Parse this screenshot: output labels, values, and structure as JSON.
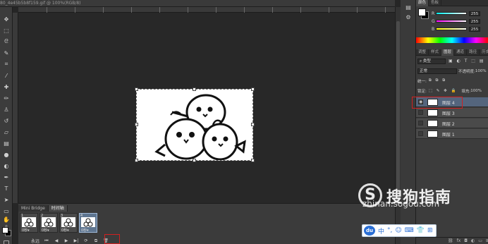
{
  "app": {
    "document_title": "80_4e45b5b8f159.gif @ 100%(RGB/8)"
  },
  "color_panel": {
    "tabs": [
      "颜色",
      "色板"
    ],
    "sliders": [
      {
        "label": "R",
        "value": "255",
        "color_from": "#00ffff",
        "color_to": "#ffffff"
      },
      {
        "label": "G",
        "value": "255",
        "color_from": "#ff00ff",
        "color_to": "#ffffff"
      },
      {
        "label": "B",
        "value": "255",
        "color_from": "#ffff00",
        "color_to": "#ffffff"
      }
    ],
    "foreground": "#ffffff",
    "background": "#000000"
  },
  "layers_panel": {
    "tabs": [
      "调整",
      "样式",
      "图层",
      "通道",
      "路径",
      "历史"
    ],
    "filter_label": "类型",
    "blend_mode": "正常",
    "opacity_label": "不透明度:",
    "opacity_value": "100%",
    "lock_label": "锁定:",
    "fill_label": "填充:",
    "fill_value": "100%",
    "unify_label": "统一:",
    "layers": [
      {
        "name": "图层 4",
        "visible": true,
        "selected": true
      },
      {
        "name": "图层 3",
        "visible": false,
        "selected": false
      },
      {
        "name": "图层 2",
        "visible": false,
        "selected": false
      },
      {
        "name": "图层 1",
        "visible": false,
        "selected": false
      }
    ]
  },
  "timeline": {
    "tabs": [
      "Mini Bridge",
      "时间轴"
    ],
    "frames": [
      {
        "number": "1",
        "duration": "0秒▾"
      },
      {
        "number": "2",
        "duration": "0秒▾"
      },
      {
        "number": "3",
        "duration": "0秒▾"
      },
      {
        "number": "4",
        "duration": "0秒▾"
      }
    ],
    "loop_label": "永远",
    "controls": [
      "⏮",
      "◀",
      "▶",
      "▶|",
      "⟳",
      "⧉",
      "🗑"
    ]
  },
  "watermark": {
    "logo_letter": "S",
    "brand": "搜狗指南",
    "url": "zhinan.sogou.com"
  },
  "ime": {
    "logo": "du",
    "label": "中",
    "icons": [
      "°,",
      "☺",
      "⌨",
      "👕",
      "⊞"
    ]
  },
  "icons": {
    "tools": [
      "move-icon",
      "marquee-icon",
      "lasso-icon",
      "quick-select-icon",
      "crop-icon",
      "eyedropper-icon",
      "healing-brush-icon",
      "brush-icon",
      "clone-stamp-icon",
      "history-brush-icon",
      "eraser-icon",
      "gradient-icon",
      "blur-icon",
      "dodge-icon",
      "pen-icon",
      "type-icon",
      "path-select-icon",
      "shape-icon",
      "hand-icon",
      "zoom-icon"
    ]
  }
}
